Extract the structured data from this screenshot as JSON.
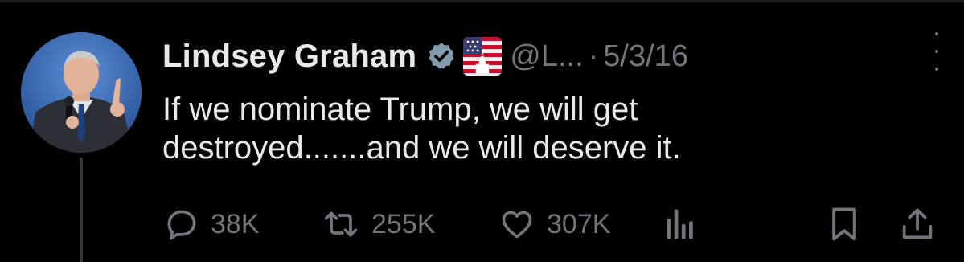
{
  "author": {
    "display_name": "Lindsey Graham",
    "handle": "@L...",
    "separator": "·",
    "date": "5/3/16",
    "verified_icon": "verified-badge-icon",
    "affiliation_icon": "us-flag-capitol-icon"
  },
  "tweet": {
    "lines": [
      "If we nominate Trump, we will get",
      "destroyed.......and we will deserve it."
    ]
  },
  "actions": {
    "reply": {
      "icon": "reply-icon",
      "count": "38K"
    },
    "repost": {
      "icon": "repost-icon",
      "count": "255K"
    },
    "like": {
      "icon": "heart-icon",
      "count": "307K"
    },
    "views": {
      "icon": "analytics-icon"
    },
    "bookmark": {
      "icon": "bookmark-icon"
    },
    "share": {
      "icon": "share-icon"
    }
  },
  "colors": {
    "background": "#000000",
    "text_primary": "#e7e9ea",
    "text_secondary": "#71767b",
    "verified_badge": "#829aab",
    "thread_line": "#333639"
  }
}
